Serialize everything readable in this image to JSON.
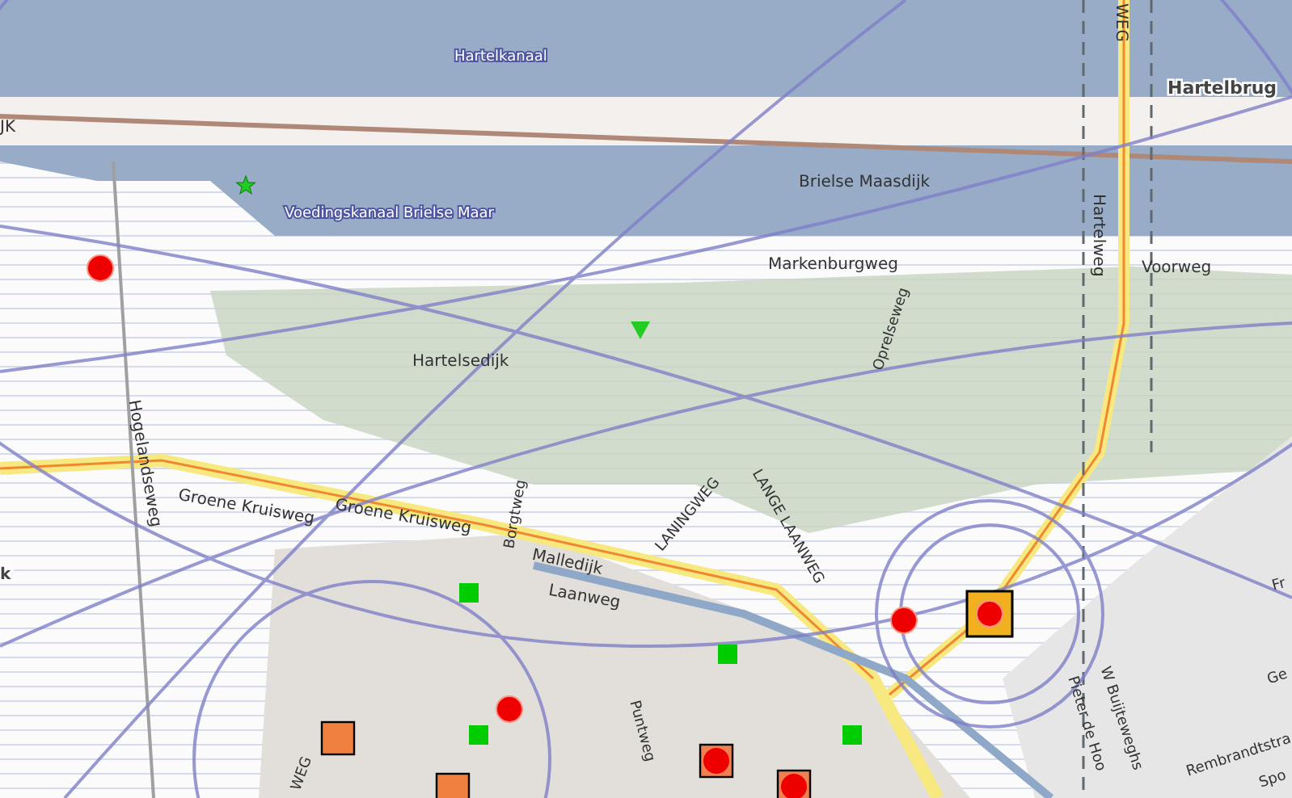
{
  "map": {
    "labels": [
      {
        "text": "Hartelkanaal",
        "kind": "water"
      },
      {
        "text": "JK",
        "kind": "road"
      },
      {
        "text": "Hartelbrug",
        "kind": "place"
      },
      {
        "text": "Brielse Maasdijk",
        "kind": "road"
      },
      {
        "text": "Voedingskanaal Brielse Maar",
        "kind": "water"
      },
      {
        "text": "Markenburgweg",
        "kind": "road"
      },
      {
        "text": "Voorweg",
        "kind": "road"
      },
      {
        "text": "Hartelweg",
        "kind": "road"
      },
      {
        "text": "WEG",
        "kind": "road"
      },
      {
        "text": "Hartelsedijk",
        "kind": "road"
      },
      {
        "text": "Oprelseweg",
        "kind": "road"
      },
      {
        "text": "Hogelandseweg",
        "kind": "road"
      },
      {
        "text": "Groene Kruisweg",
        "kind": "road"
      },
      {
        "text": "Groene Kruisweg",
        "kind": "road"
      },
      {
        "text": "Borgtweg",
        "kind": "road"
      },
      {
        "text": "Malledijk",
        "kind": "road"
      },
      {
        "text": "Laanweg",
        "kind": "road"
      },
      {
        "text": "LANINGWEG",
        "kind": "road"
      },
      {
        "text": "LANGE LAANWEG",
        "kind": "road"
      },
      {
        "text": "Puntweg",
        "kind": "road"
      },
      {
        "text": "W Buijteweghs",
        "kind": "road"
      },
      {
        "text": "Pieter de Hoo",
        "kind": "road"
      },
      {
        "text": "Rembrandtstra",
        "kind": "road"
      },
      {
        "text": "Spo",
        "kind": "road"
      },
      {
        "text": "Ge",
        "kind": "road"
      },
      {
        "text": "Fr",
        "kind": "road"
      },
      {
        "text": "k",
        "kind": "place"
      },
      {
        "text": "WEG",
        "kind": "road"
      }
    ],
    "markers": [
      {
        "kind": "circle",
        "selected": false
      },
      {
        "kind": "circle",
        "selected": false
      },
      {
        "kind": "circle",
        "selected": false
      },
      {
        "kind": "circle",
        "selected": true
      },
      {
        "kind": "boxed",
        "selected": false
      },
      {
        "kind": "boxed",
        "selected": false
      },
      {
        "kind": "square",
        "selected": false
      },
      {
        "kind": "square",
        "selected": false
      },
      {
        "kind": "green",
        "selected": false
      },
      {
        "kind": "green",
        "selected": false
      },
      {
        "kind": "green",
        "selected": false
      },
      {
        "kind": "green",
        "selected": false
      },
      {
        "kind": "star",
        "selected": false
      },
      {
        "kind": "triangle",
        "selected": false
      }
    ]
  }
}
